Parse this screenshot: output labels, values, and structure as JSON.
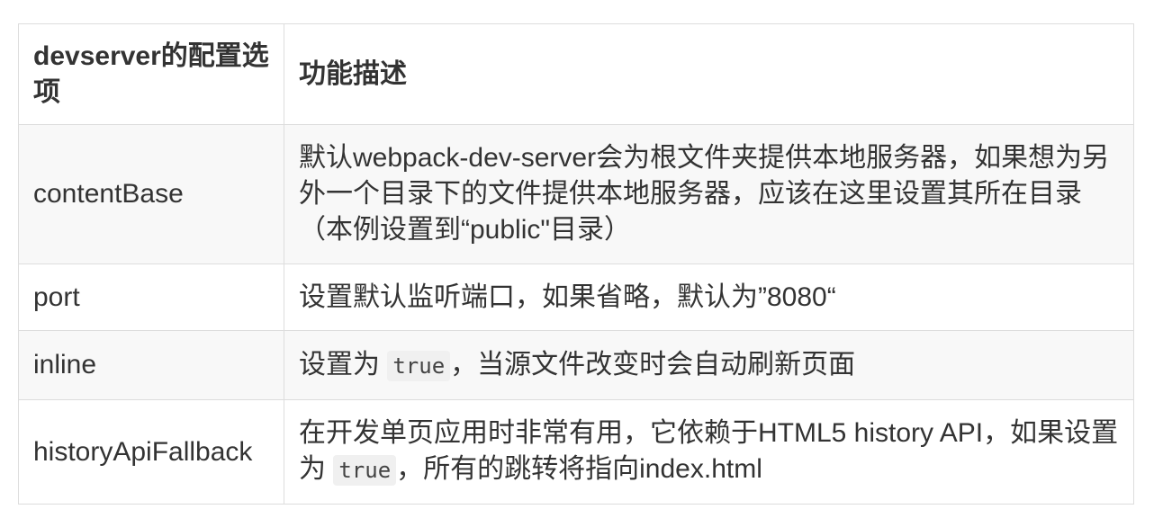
{
  "table": {
    "headers": [
      "devserver的配置选项",
      "功能描述"
    ],
    "rows": [
      {
        "option": "contentBase",
        "desc": "默认webpack-dev-server会为根文件夹提供本地服务器，如果想为另外一个目录下的文件提供本地服务器，应该在这里设置其所在目录（本例设置到“public\"目录）"
      },
      {
        "option": "port",
        "desc": "设置默认监听端口，如果省略，默认为”8080“"
      },
      {
        "option": "inline",
        "desc_before": "设置为",
        "desc_code": "true",
        "desc_after": "，当源文件改变时会自动刷新页面"
      },
      {
        "option": "historyApiFallback",
        "desc_before": "在开发单页应用时非常有用，它依赖于HTML5 history API，如果设置为",
        "desc_code": "true",
        "desc_after": "，所有的跳转将指向index.html"
      }
    ]
  }
}
